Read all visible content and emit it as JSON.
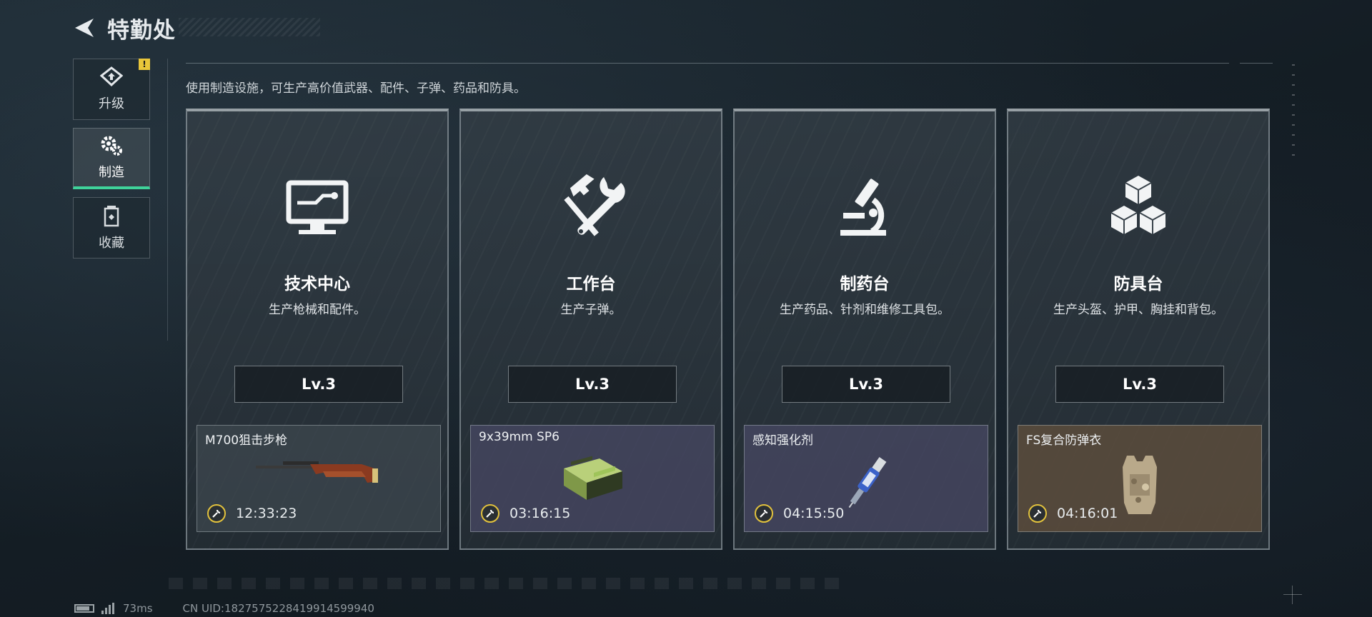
{
  "header": {
    "title": "特勤处",
    "back_icon": "back-arrow-icon"
  },
  "sidebar": {
    "items": [
      {
        "label": "升级",
        "icon": "upgrade-icon",
        "badge": "!",
        "active": false
      },
      {
        "label": "制造",
        "icon": "gears-icon",
        "active": true
      },
      {
        "label": "收藏",
        "icon": "collection-icon",
        "active": false
      }
    ]
  },
  "description": "使用制造设施，可生产高价值武器、配件、子弹、药品和防具。",
  "cards": [
    {
      "title": "技术中心",
      "subtitle": "生产枪械和配件。",
      "icon": "computer-icon",
      "level": "Lv.3",
      "item": {
        "name": "M700狙击步枪",
        "time": "12:33:23",
        "image": "rifle-image",
        "bg": "gray"
      }
    },
    {
      "title": "工作台",
      "subtitle": "生产子弹。",
      "icon": "hammer-wrench-icon",
      "level": "Lv.3",
      "item": {
        "name": "9x39mm SP6",
        "time": "03:16:15",
        "image": "ammo-box-image",
        "bg": "purple"
      }
    },
    {
      "title": "制药台",
      "subtitle": "生产药品、针剂和维修工具包。",
      "icon": "microscope-icon",
      "level": "Lv.3",
      "item": {
        "name": "感知强化剂",
        "time": "04:15:50",
        "image": "injector-image",
        "bg": "purple"
      }
    },
    {
      "title": "防具台",
      "subtitle": "生产头盔、护甲、胸挂和背包。",
      "icon": "cubes-icon",
      "level": "Lv.3",
      "item": {
        "name": "FS复合防弹衣",
        "time": "04:16:01",
        "image": "body-armor-image",
        "bg": "brown"
      }
    }
  ],
  "footer": {
    "ping": "73ms",
    "uid": "CN UID:1827575228419914599940"
  },
  "colors": {
    "accent": "#3fd39a",
    "badge": "#e9c63a",
    "timer_ring": "#e2c23d"
  }
}
